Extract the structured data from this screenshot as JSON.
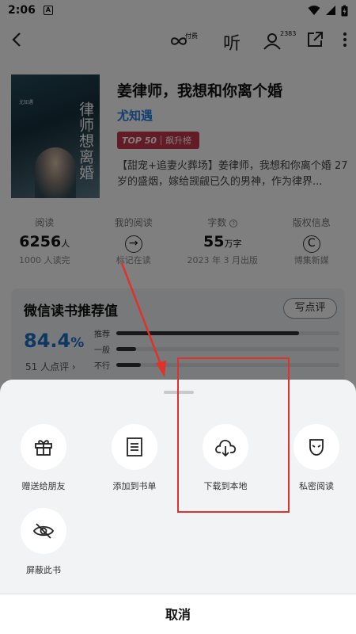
{
  "status_bar": {
    "time": "2:06",
    "notification_letter": "A"
  },
  "nav": {
    "paid_label": "付费",
    "listen_label": "听",
    "readers_count": "2383"
  },
  "book": {
    "title": "姜律师，我想和你离个婚",
    "author": "尤知遇",
    "rank_top": "TOP 50",
    "rank_name": "飙升榜",
    "description": "【甜宠+追妻火葬场】姜律师，我想和你离个婚 27岁的盛烟，嫁给觊觎已久的男神，作为律界...",
    "cover_text_main": "律师想离婚",
    "cover_text_small": "尤知遇"
  },
  "stats": [
    {
      "label": "阅读",
      "value": "6256",
      "unit": "人",
      "sub": "1000 人读完"
    },
    {
      "label": "我的阅读",
      "icon": "arrow-right-circle-icon",
      "sub": "标记在读"
    },
    {
      "label": "字数",
      "value": "55",
      "unit": "万字",
      "sub": "2023 年 3 月出版"
    },
    {
      "label": "版权信息",
      "icon": "copyright-icon",
      "sub": "博集新媒"
    }
  ],
  "recommend": {
    "title": "微信读书推荐值",
    "write_button": "写点评",
    "percent": "84.4",
    "percent_sign": "%",
    "count": "51 人点评",
    "bars": [
      {
        "label": "推荐",
        "fraction": 0.82
      },
      {
        "label": "一般",
        "fraction": 0.09
      },
      {
        "label": "不行",
        "fraction": 0.11
      }
    ]
  },
  "sheet": {
    "options": [
      {
        "label": "赠送给朋友",
        "icon": "gift-icon"
      },
      {
        "label": "添加到书单",
        "icon": "list-icon"
      },
      {
        "label": "下载到本地",
        "icon": "cloud-download-icon"
      },
      {
        "label": "私密阅读",
        "icon": "mask-icon"
      },
      {
        "label": "屏蔽此书",
        "icon": "eye-off-icon"
      }
    ],
    "cancel_label": "取消"
  },
  "colors": {
    "accent": "#2a7fe0",
    "rank_badge": "#c7364b",
    "annotation_red": "#e0322a",
    "percent_blue": "#1e6ec8"
  }
}
